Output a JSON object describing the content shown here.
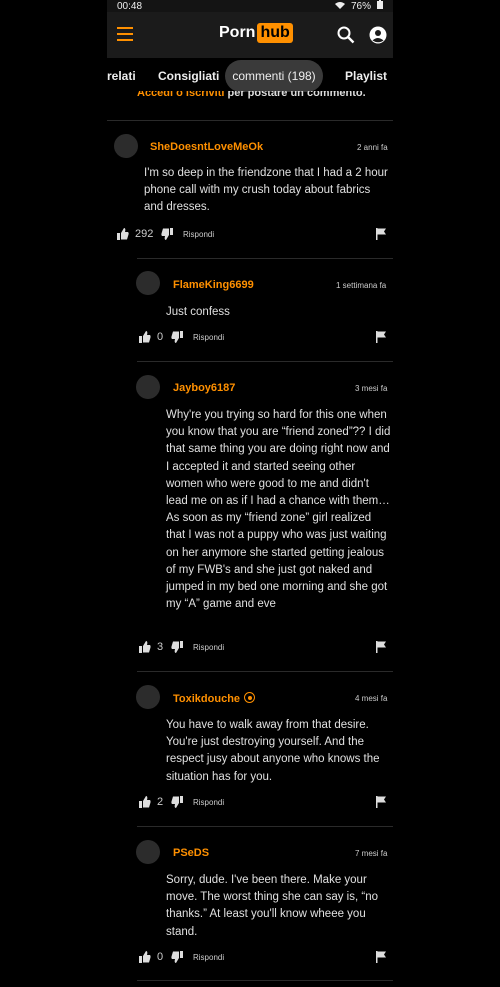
{
  "status": {
    "time": "00:48",
    "battery": "76%"
  },
  "header": {
    "logo_left": "Porn",
    "logo_right": "hub"
  },
  "tabs": [
    {
      "label": "relati"
    },
    {
      "label": "Consigliati"
    },
    {
      "label": "commenti (198)"
    },
    {
      "label": "Playlist"
    }
  ],
  "banner": {
    "link": "Accedi o iscriviti",
    "rest": " per postare un commento."
  },
  "comments": [
    {
      "user": "SheDoesntLoveMeOk",
      "date": "2 anni fa",
      "text": "I'm so deep in the friendzone that I had a 2 hour phone call with my crush today about fabrics and dresses.",
      "likes": "292",
      "reply": "Rispondi"
    },
    {
      "user": "FlameKing6699",
      "date": "1 settimana fa",
      "text": "Just confess",
      "likes": "0",
      "reply": "Rispondi"
    },
    {
      "user": "Jayboy6187",
      "date": "3 mesi fa",
      "text": "Why're you trying so hard for this one when you know that you are “friend zoned”?? I did that same thing you are doing right now and I accepted it and started seeing other women who were good to me and didn't lead me on as if I had a chance with them… As soon as my “friend zone” girl realized that I was not a puppy who was just waiting on her anymore she started getting jealous of my FWB's and she just got naked and jumped in my bed one morning and she got my “A” game and eve",
      "likes": "3",
      "reply": "Rispondi"
    },
    {
      "user": "Toxikdouche",
      "date": "4 mesi fa",
      "text": "You have to walk away from that desire. You're just destroying yourself. And the respect jusy about anyone who knows the situation has for you.",
      "likes": "2",
      "reply": "Rispondi"
    },
    {
      "user": "PSeDS",
      "date": "7 mesi fa",
      "text": "Sorry, dude. I've been there. Make your move. The worst thing she can say is, “no thanks.” At least you'll know wheee you stand.",
      "likes": "0",
      "reply": "Rispondi"
    }
  ]
}
